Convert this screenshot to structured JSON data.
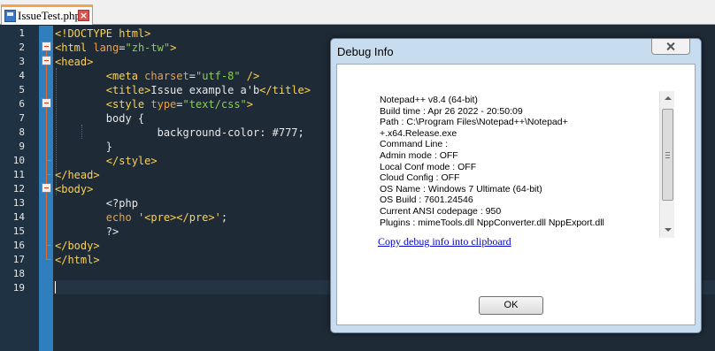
{
  "tab": {
    "filename": "IssueTest.php",
    "accent": "#f5a447"
  },
  "editor": {
    "lines": [
      {
        "n": "1",
        "segs": [
          {
            "c": "kw",
            "t": "<!DOCTYPE html>"
          }
        ]
      },
      {
        "n": "2",
        "segs": [
          {
            "c": "kw",
            "t": "<html "
          },
          {
            "c": "att",
            "t": "lang"
          },
          {
            "c": "txt",
            "t": "="
          },
          {
            "c": "str",
            "t": "\"zh-tw\""
          },
          {
            "c": "kw",
            "t": ">"
          }
        ]
      },
      {
        "n": "3",
        "segs": [
          {
            "c": "kw",
            "t": "<head>"
          }
        ]
      },
      {
        "n": "4",
        "segs": [
          {
            "c": "txt",
            "t": "        "
          },
          {
            "c": "kw",
            "t": "<meta "
          },
          {
            "c": "att",
            "t": "charset"
          },
          {
            "c": "txt",
            "t": "="
          },
          {
            "c": "str",
            "t": "\"utf-8\""
          },
          {
            "c": "kw",
            "t": " />"
          }
        ]
      },
      {
        "n": "5",
        "segs": [
          {
            "c": "txt",
            "t": "        "
          },
          {
            "c": "kw",
            "t": "<title>"
          },
          {
            "c": "txt",
            "t": "Issue example a'b"
          },
          {
            "c": "kw",
            "t": "</title>"
          }
        ]
      },
      {
        "n": "6",
        "segs": [
          {
            "c": "txt",
            "t": "        "
          },
          {
            "c": "kw",
            "t": "<style "
          },
          {
            "c": "att",
            "t": "type"
          },
          {
            "c": "txt",
            "t": "="
          },
          {
            "c": "str",
            "t": "\"text/css\""
          },
          {
            "c": "kw",
            "t": ">"
          }
        ]
      },
      {
        "n": "7",
        "segs": [
          {
            "c": "txt",
            "t": "        body {"
          }
        ]
      },
      {
        "n": "8",
        "segs": [
          {
            "c": "txt",
            "t": "                background-color: #777;"
          }
        ]
      },
      {
        "n": "9",
        "segs": [
          {
            "c": "txt",
            "t": "        }"
          }
        ]
      },
      {
        "n": "10",
        "segs": [
          {
            "c": "txt",
            "t": "        "
          },
          {
            "c": "kw",
            "t": "</style>"
          }
        ]
      },
      {
        "n": "11",
        "segs": [
          {
            "c": "kw",
            "t": "</head>"
          }
        ]
      },
      {
        "n": "12",
        "segs": [
          {
            "c": "kw",
            "t": "<body>"
          }
        ]
      },
      {
        "n": "13",
        "segs": [
          {
            "c": "txt",
            "t": "        <?php"
          }
        ]
      },
      {
        "n": "14",
        "segs": [
          {
            "c": "txt",
            "t": "        "
          },
          {
            "c": "att",
            "t": "echo"
          },
          {
            "c": "txt",
            "t": " "
          },
          {
            "c": "kw",
            "t": "'<pre></pre>'"
          },
          {
            "c": "txt",
            "t": ";"
          }
        ]
      },
      {
        "n": "15",
        "segs": [
          {
            "c": "txt",
            "t": "        ?>"
          }
        ]
      },
      {
        "n": "16",
        "segs": [
          {
            "c": "kw",
            "t": "</body>"
          }
        ]
      },
      {
        "n": "17",
        "segs": [
          {
            "c": "kw",
            "t": "</html>"
          }
        ]
      },
      {
        "n": "18",
        "segs": []
      },
      {
        "n": "19",
        "segs": []
      }
    ]
  },
  "dialog": {
    "title": "Debug Info",
    "info_lines": [
      "Notepad++ v8.4   (64-bit)",
      "Build time : Apr 26 2022 - 20:50:09",
      "Path : C:\\Program Files\\Notepad++\\Notepad+",
      "+.x64.Release.exe",
      "Command Line :",
      "Admin mode : OFF",
      "Local Conf mode : OFF",
      "Cloud Config : OFF",
      "OS Name : Windows 7 Ultimate (64-bit)",
      "OS Build : 7601.24546",
      "Current ANSI codepage : 950",
      "Plugins : mimeTools.dll NppConverter.dll NppExport.dll"
    ],
    "copy_link": "Copy debug info into clipboard",
    "ok_label": "OK"
  }
}
